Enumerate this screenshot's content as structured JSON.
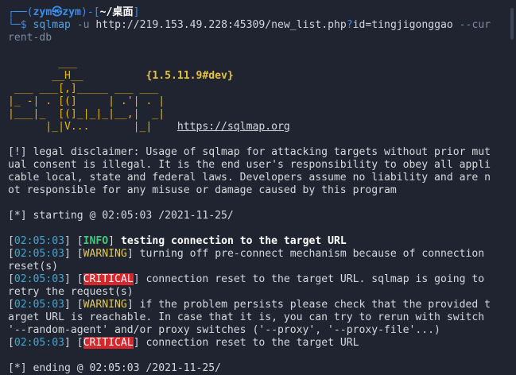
{
  "prompt": {
    "line1_open": "┌──(",
    "user": "zym㉿zym",
    "line1_mid": ")-[",
    "path": "~/桌面",
    "line1_close": "]",
    "line2_prefix": "└─$ ",
    "command": "sqlmap",
    "opt_u": "-u",
    "url": "http://219.153.49.228:45309/new_list.php",
    "url_q": "?",
    "url_param": "id=tingjigonggao",
    "opt_cur": "--cur",
    "opt_cur2": "rent-db"
  },
  "logo": {
    "l1": "        ___",
    "l2": "       __H__",
    "l3": " ___ ___[,]_____ ___ ___  ",
    "l4": "|_ -| . [(]     | .'| . |",
    "l5": "|___|_  [(]_|_|_|__,|  _|",
    "l6": "      |_|V...       |_|   ",
    "version": "{1.5.11.9#dev}",
    "url": "https://sqlmap.org"
  },
  "disclaimer": [
    "[!] legal disclaimer: Usage of sqlmap for attacking targets without prior mut",
    "ual consent is illegal. It is the end user's responsibility to obey all appli",
    "cable local, state and federal laws. Developers assume no liability and are n",
    "ot responsible for any misuse or damage caused by this program"
  ],
  "starting": "[*] starting @ 02:05:03 /2021-11-25/",
  "log": [
    {
      "time": "02:05:03",
      "level": "INFO",
      "text": "testing connection to the target URL",
      "cont": ""
    },
    {
      "time": "02:05:03",
      "level": "WARNING",
      "text": "turning off pre-connect mechanism because of connection",
      "cont": "reset(s)"
    },
    {
      "time": "02:05:03",
      "level": "CRITICAL",
      "text": "connection reset to the target URL. sqlmap is going to",
      "cont": "retry the request(s)"
    },
    {
      "time": "02:05:03",
      "level": "WARNING",
      "text": "if the problem persists please check that the provided t",
      "cont": "arget URL is reachable. In case that it is, you can try to rerun with switch",
      "cont2": "'--random-agent' and/or proxy switches ('--proxy', '--proxy-file'...)"
    },
    {
      "time": "02:05:03",
      "level": "CRITICAL",
      "text": "connection reset to the target URL",
      "cont": ""
    }
  ],
  "ending": "[*] ending @ 02:05:03 /2021-11-25/",
  "colors": {
    "background": "#1f2430",
    "info": "#41c97a",
    "warning": "#e3c94a",
    "critical_bg": "#d8262c",
    "timestamp": "#3da7d8",
    "logo": "#e6b800"
  }
}
